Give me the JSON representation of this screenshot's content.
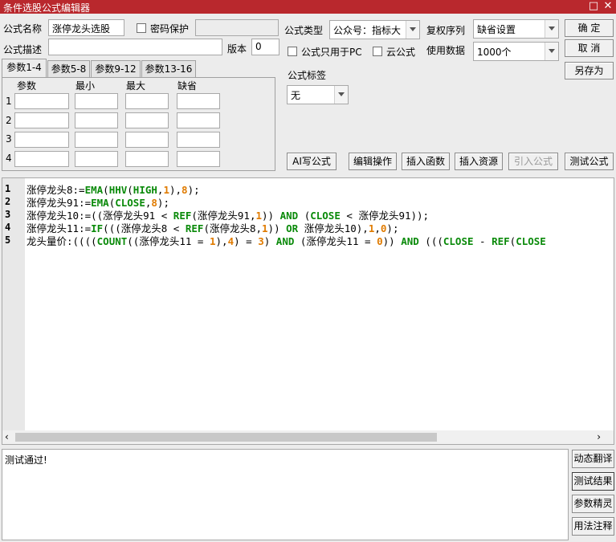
{
  "window": {
    "title": "条件选股公式编辑器",
    "max_icon": "maximize-icon",
    "close_icon": "close-icon"
  },
  "form": {
    "name_label": "公式名称",
    "name_value": "涨停龙头选股",
    "password_label": "密码保护",
    "password_checked": false,
    "desc_label": "公式描述",
    "desc_value": "",
    "version_label": "版本",
    "version_value": "0",
    "type_label": "公式类型",
    "type_value": "公众号：指标大",
    "pc_only_label": "公式只用于PC",
    "cloud_label": "云公式",
    "rights_label": "复权序列",
    "rights_value": "缺省设置",
    "data_label": "使用数据",
    "data_value": "1000个",
    "tag_label": "公式标签",
    "tag_value": "无"
  },
  "buttons": {
    "ok": "确  定",
    "cancel": "取  消",
    "save_as": "另存为",
    "ai_write": "AI写公式",
    "edit_ops": "编辑操作",
    "insert_func": "插入函数",
    "insert_res": "插入资源",
    "import_formula": "引入公式",
    "test_formula": "测试公式"
  },
  "param_tabs": [
    "参数1-4",
    "参数5-8",
    "参数9-12",
    "参数13-16"
  ],
  "param_headers": [
    "参数",
    "最小",
    "最大",
    "缺省"
  ],
  "param_rows": [
    "1",
    "2",
    "3",
    "4"
  ],
  "code_lines": [
    {
      "n": "1"
    },
    {
      "n": "2"
    },
    {
      "n": "3"
    },
    {
      "n": "4"
    },
    {
      "n": "5"
    }
  ],
  "code": {
    "l1": [
      [
        "t",
        "涨停龙头8:="
      ],
      [
        "k",
        "EMA"
      ],
      [
        "t",
        "("
      ],
      [
        "k",
        "HHV"
      ],
      [
        "t",
        "("
      ],
      [
        "k",
        "HIGH"
      ],
      [
        "t",
        ","
      ],
      [
        "n",
        "1"
      ],
      [
        "t",
        "),"
      ],
      [
        "n",
        "8"
      ],
      [
        "t",
        ");"
      ]
    ],
    "l2": [
      [
        "t",
        "涨停龙头91:="
      ],
      [
        "k",
        "EMA"
      ],
      [
        "t",
        "("
      ],
      [
        "k",
        "CLOSE"
      ],
      [
        "t",
        ","
      ],
      [
        "n",
        "8"
      ],
      [
        "t",
        ");"
      ]
    ],
    "l3": [
      [
        "t",
        "涨停龙头10:=((涨停龙头91 < "
      ],
      [
        "k",
        "REF"
      ],
      [
        "t",
        "(涨停龙头91,"
      ],
      [
        "n",
        "1"
      ],
      [
        "t",
        ")) "
      ],
      [
        "k",
        "AND"
      ],
      [
        "t",
        " ("
      ],
      [
        "k",
        "CLOSE"
      ],
      [
        "t",
        " < 涨停龙头91));"
      ]
    ],
    "l4": [
      [
        "t",
        "涨停龙头11:="
      ],
      [
        "k",
        "IF"
      ],
      [
        "t",
        "(((涨停龙头8 < "
      ],
      [
        "k",
        "REF"
      ],
      [
        "t",
        "(涨停龙头8,"
      ],
      [
        "n",
        "1"
      ],
      [
        "t",
        ")) "
      ],
      [
        "k",
        "OR"
      ],
      [
        "t",
        " 涨停龙头10),"
      ],
      [
        "n",
        "1"
      ],
      [
        "t",
        ","
      ],
      [
        "n",
        "0"
      ],
      [
        "t",
        ");"
      ]
    ],
    "l5": [
      [
        "t",
        "龙头量价:(((("
      ],
      [
        "k",
        "COUNT"
      ],
      [
        "t",
        "((涨停龙头11 = "
      ],
      [
        "n",
        "1"
      ],
      [
        "t",
        "),"
      ],
      [
        "n",
        "4"
      ],
      [
        "t",
        ") = "
      ],
      [
        "n",
        "3"
      ],
      [
        "t",
        ") "
      ],
      [
        "k",
        "AND"
      ],
      [
        "t",
        " (涨停龙头11 = "
      ],
      [
        "n",
        "0"
      ],
      [
        "t",
        "))"
      ],
      [
        "t",
        " "
      ],
      [
        "k",
        "AND"
      ],
      [
        "t",
        " ((("
      ],
      [
        "k",
        "CLOSE"
      ],
      [
        "t",
        " - "
      ],
      [
        "k",
        "REF"
      ],
      [
        "t",
        "("
      ],
      [
        "k",
        "CLOSE"
      ]
    ]
  },
  "output_text": "测试通过!",
  "side_buttons": [
    "动态翻译",
    "测试结果",
    "参数精灵",
    "用法注释"
  ],
  "colors": {
    "titlebar": "#b9282d",
    "keyword": "#0a8a0a",
    "number": "#e07b00"
  }
}
